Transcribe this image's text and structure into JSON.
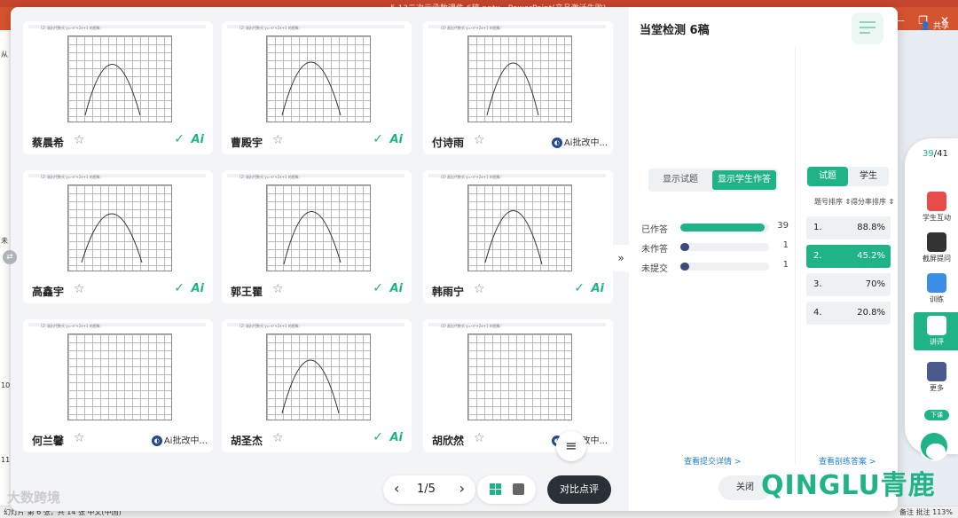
{
  "ppt": {
    "title": "5.13二次元函数课件 6稿.pptx - PowerPoint(产品激活失败)",
    "share": "共享",
    "status_left": "幻灯片 第 6 张，共 14 张   中文(中国)",
    "status_right": "备注   批注   113%",
    "side_marks": [
      "从",
      "未",
      "10",
      "11"
    ]
  },
  "gallery": {
    "question_text": "(2) 画出代数式 y=-x²+2x+1 的图象:",
    "cards": [
      {
        "name": "蔡晨希",
        "status": "done"
      },
      {
        "name": "曹殿宇",
        "status": "done"
      },
      {
        "name": "付诗雨",
        "status": "pending",
        "pending_text": "Ai批改中..."
      },
      {
        "name": "高鑫宇",
        "status": "done"
      },
      {
        "name": "郭王瞿",
        "status": "done"
      },
      {
        "name": "韩雨宁",
        "status": "done"
      },
      {
        "name": "何兰馨",
        "status": "pending",
        "pending_text": "Ai批改中..."
      },
      {
        "name": "胡圣杰",
        "status": "done"
      },
      {
        "name": "胡欣然",
        "status": "pending",
        "pending_text": "Ai批改中..."
      }
    ],
    "ai_label": "Ai",
    "check_glyph": "✓",
    "star_glyph": "☆"
  },
  "pager": {
    "prev": "‹",
    "page": "1/5",
    "next": "›"
  },
  "compare_label": "对比点评",
  "menu_glyph": "≡",
  "collapse_glyph": "»",
  "panel": {
    "title": "当堂检测 6稿",
    "toggle": {
      "show_question": "显示试题",
      "show_answers": "显示学生作答"
    },
    "stats": [
      {
        "label": "已作答",
        "count": "39",
        "fraction": 0.95,
        "color": "#1fb387"
      },
      {
        "label": "未作答",
        "count": "1",
        "fraction": 0.06,
        "color": "#3b4a7a"
      },
      {
        "label": "未提交",
        "count": "1",
        "fraction": 0.06,
        "color": "#3b4a7a"
      }
    ],
    "view_submit_link": "查看提交详情 >",
    "tabs": {
      "question": "试题",
      "student": "学生"
    },
    "sort": {
      "by_number": "题号排序 ⇕",
      "by_score": "得分率排序 ⇕"
    },
    "rankings": [
      {
        "n": "1.",
        "v": "88.8%",
        "active": false
      },
      {
        "n": "2.",
        "v": "45.2%",
        "active": true
      },
      {
        "n": "3.",
        "v": "70%",
        "active": false
      },
      {
        "n": "4.",
        "v": "20.8%",
        "active": false
      }
    ],
    "view_answer_link": "查看剖练答案 >"
  },
  "close_label": "关闭",
  "toolbar": {
    "count_current": "39",
    "count_total": "/41",
    "items": [
      {
        "label": "学生互动",
        "color": "#e94b4b"
      },
      {
        "label": "截屏提问",
        "color": "#333333"
      },
      {
        "label": "训练",
        "color": "#3a8ee6"
      },
      {
        "label": "讲评",
        "color": "#1fb387"
      },
      {
        "label": "更多",
        "color": "#4a5a8a"
      }
    ],
    "badge": "下课"
  },
  "watermark_left": "大数跨境",
  "watermark_right": "QINGLU青鹿",
  "colors": {
    "accent": "#1fb387",
    "dark": "#2b2f36",
    "link": "#1f7fd1"
  }
}
